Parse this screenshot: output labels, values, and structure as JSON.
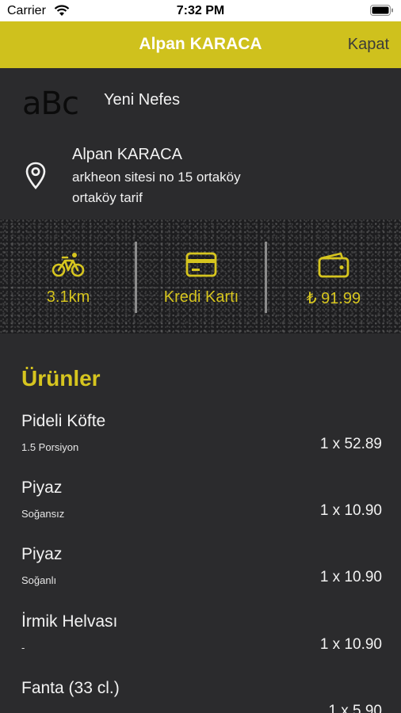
{
  "status_bar": {
    "carrier": "Carrier",
    "time": "7:32 PM"
  },
  "nav": {
    "title": "Alpan KARACA",
    "close_label": "Kapat"
  },
  "restaurant": {
    "logo_text": "aBc",
    "name": "Yeni Nefes"
  },
  "address": {
    "name": "Alpan KARACA",
    "line1": "arkheon sitesi no 15 ortaköy",
    "line2": "ortaköy tarif"
  },
  "info": {
    "distance": "3.1km",
    "payment": "Kredi Kartı",
    "total": "₺ 91.99"
  },
  "colors": {
    "accent": "#cfc11d",
    "accent_text": "#d6c51f",
    "background": "#2b2b2d"
  },
  "products_title": "Ürünler",
  "products": [
    {
      "name": "Pideli Köfte",
      "note": "1.5 Porsiyon",
      "qty": "1 x 52.89"
    },
    {
      "name": "Piyaz",
      "note": "Soğansız",
      "qty": "1 x 10.90"
    },
    {
      "name": "Piyaz",
      "note": "Soğanlı",
      "qty": "1 x 10.90"
    },
    {
      "name": "İrmik Helvası",
      "note": "-",
      "qty": "1 x 10.90"
    },
    {
      "name": "Fanta (33 cl.)",
      "note": "",
      "qty": "1 x 5.90"
    }
  ]
}
